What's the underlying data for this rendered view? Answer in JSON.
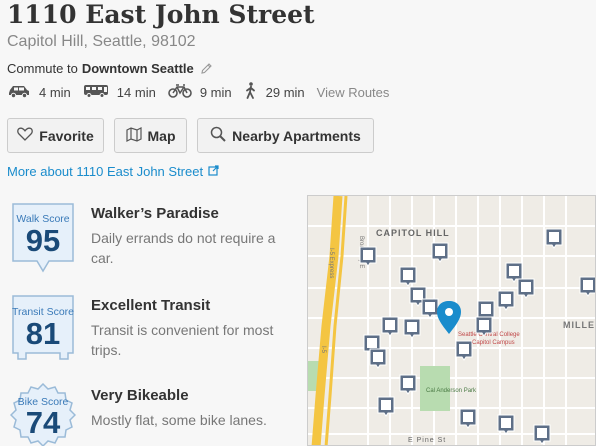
{
  "header": {
    "title": "1110 East John Street",
    "address": "Capitol Hill, Seattle, 98102"
  },
  "commute": {
    "label": "Commute to",
    "destination": "Downtown Seattle",
    "modes": [
      {
        "icon": "car-icon",
        "time": "4 min"
      },
      {
        "icon": "bus-icon",
        "time": "14 min"
      },
      {
        "icon": "bike-icon",
        "time": "9 min"
      },
      {
        "icon": "walk-icon",
        "time": "29 min"
      }
    ],
    "view_routes": "View Routes"
  },
  "actions": {
    "favorite": "Favorite",
    "map": "Map",
    "nearby": "Nearby Apartments"
  },
  "more_link": "More about 1110 East John Street",
  "scores": [
    {
      "label": "Walk Score",
      "value": "95",
      "heading": "Walker’s Paradise",
      "description": "Daily errands do not require a car."
    },
    {
      "label": "Transit Score",
      "value": "81",
      "heading": "Excellent Transit",
      "description": "Transit is convenient for most trips."
    },
    {
      "label": "Bike Score",
      "value": "74",
      "heading": "Very Bikeable",
      "description": "Mostly flat, some bike lanes."
    }
  ],
  "map": {
    "labels": {
      "capitol_hill": "CAPITOL HILL",
      "express": "I-5 Express",
      "interstate": "I-5",
      "broadway": "Broadway E",
      "e_pine": "E Pine St",
      "cal_anderson": "Cal Anderson Park",
      "miller": "MILLE",
      "seattle_central": "Seattle Central College",
      "campus": "Capitol Campus"
    },
    "colors": {
      "highway": "#f4c542",
      "park": "#b8dcb0",
      "pin": "#1a8ccc",
      "marker": "#5e6f87"
    }
  }
}
